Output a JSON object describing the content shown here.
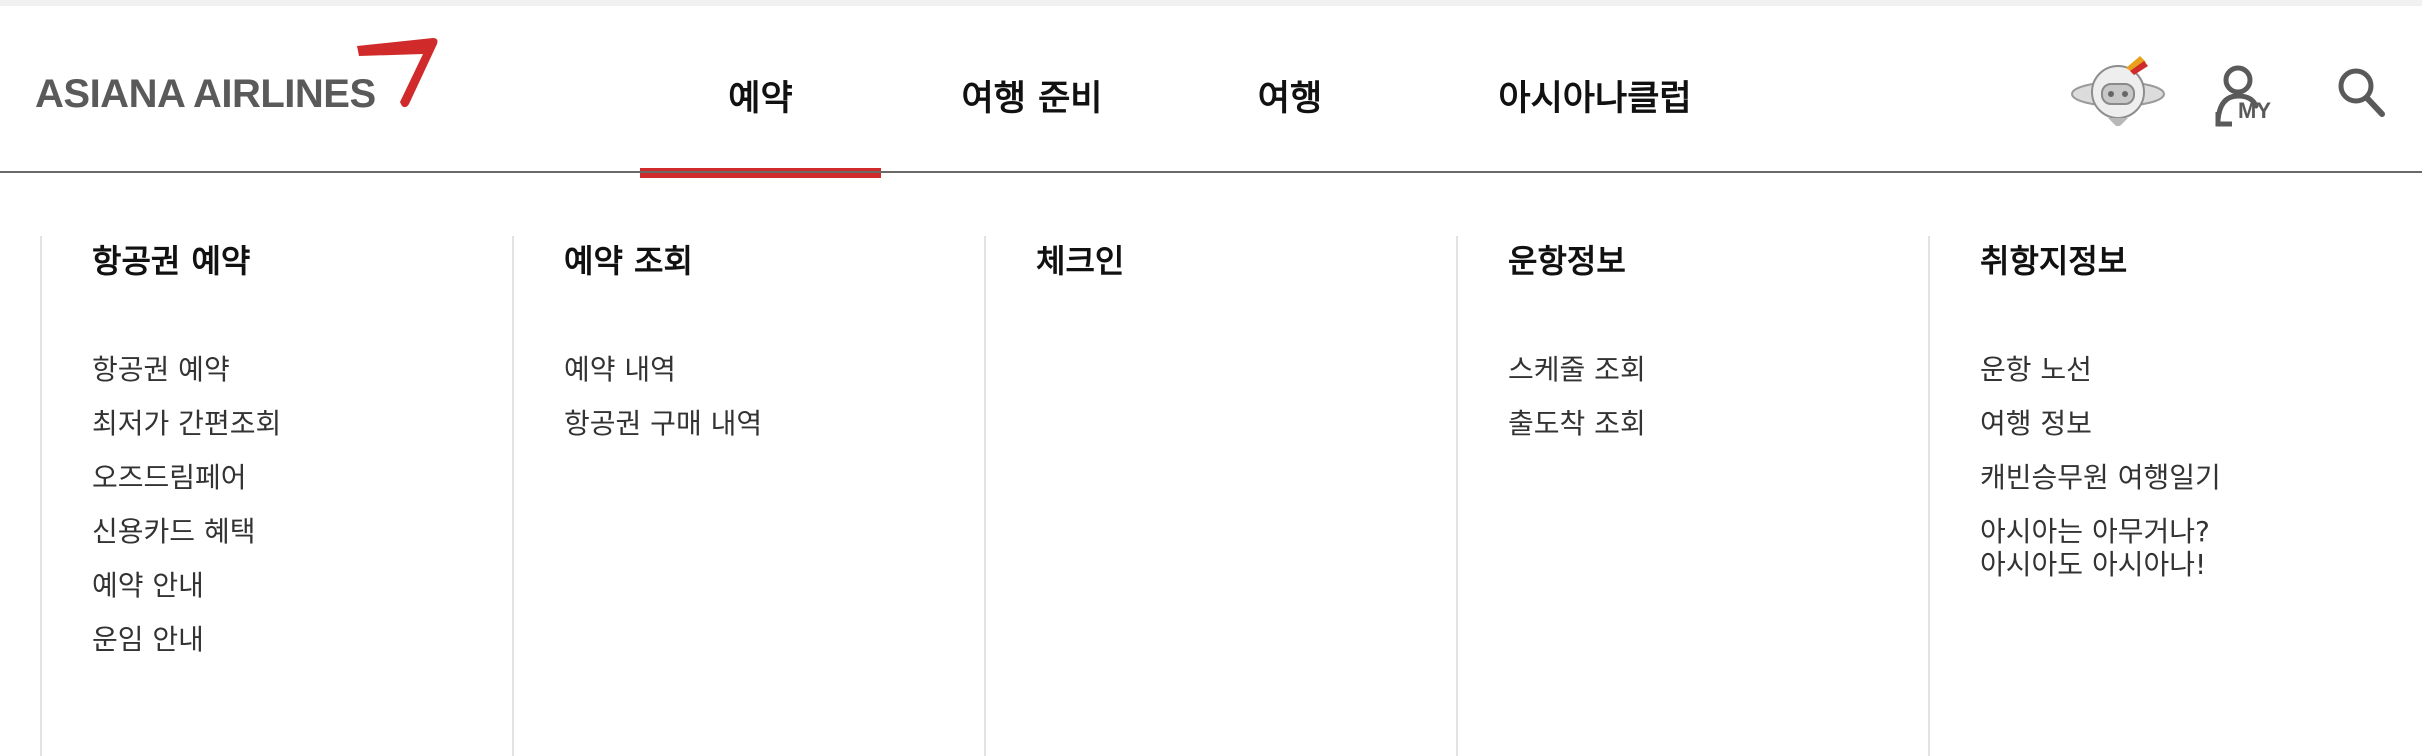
{
  "brand": {
    "name": "ASIANA AIRLINES",
    "accent_color": "#d12a2a",
    "logo_text_color": "#5a5a5a"
  },
  "nav": {
    "items": [
      {
        "label": "예약",
        "active": true
      },
      {
        "label": "여행 준비",
        "active": false
      },
      {
        "label": "여행",
        "active": false
      },
      {
        "label": "아시아나클럽",
        "active": false
      }
    ]
  },
  "utilities": {
    "assistant_icon": "chatbot-robot-icon",
    "my_label": "MY",
    "search_icon": "search-icon"
  },
  "mega_menu": {
    "columns": [
      {
        "title": "항공권 예약",
        "items": [
          "항공권 예약",
          "최저가 간편조회",
          "오즈드림페어",
          "신용카드 혜택",
          "예약 안내",
          "운임 안내"
        ]
      },
      {
        "title": "예약 조회",
        "items": [
          "예약 내역",
          "항공권 구매 내역"
        ]
      },
      {
        "title": "체크인",
        "items": []
      },
      {
        "title": "운항정보",
        "items": [
          "스케줄 조회",
          "출도착 조회"
        ]
      },
      {
        "title": "취항지정보",
        "items": [
          "운항 노선",
          "여행 정보",
          "캐빈승무원 여행일기",
          "아시아는 아무거나?\n아시아도 아시아나!"
        ]
      }
    ]
  }
}
